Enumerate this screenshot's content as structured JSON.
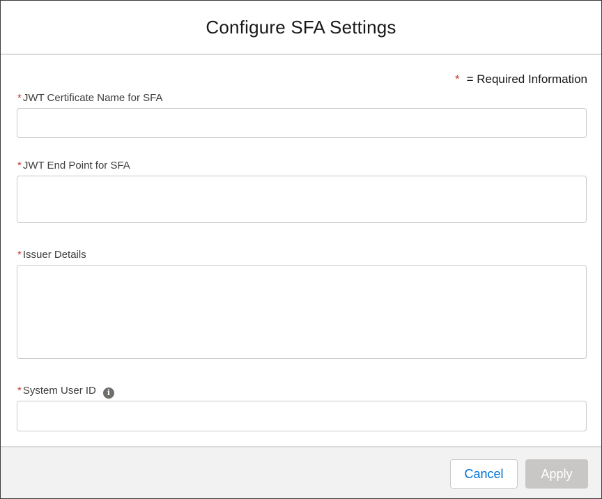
{
  "dialog": {
    "title": "Configure SFA Settings"
  },
  "required_note": {
    "marker": "*",
    "text": "= Required Information"
  },
  "fields": [
    {
      "label": "JWT Certificate Name for SFA",
      "value": "",
      "required_marker": "*"
    },
    {
      "label": "JWT End Point for SFA",
      "value": "",
      "required_marker": "*"
    },
    {
      "label": "Issuer Details",
      "value": "",
      "required_marker": "*"
    },
    {
      "label": "System User ID",
      "value": "",
      "required_marker": "*",
      "info_icon": "info-icon",
      "info_glyph": "i"
    }
  ],
  "footer": {
    "cancel_label": "Cancel",
    "apply_label": "Apply"
  },
  "colors": {
    "required": "#c23934",
    "link_blue": "#0070d2",
    "disabled_button": "#c9c7c5"
  }
}
